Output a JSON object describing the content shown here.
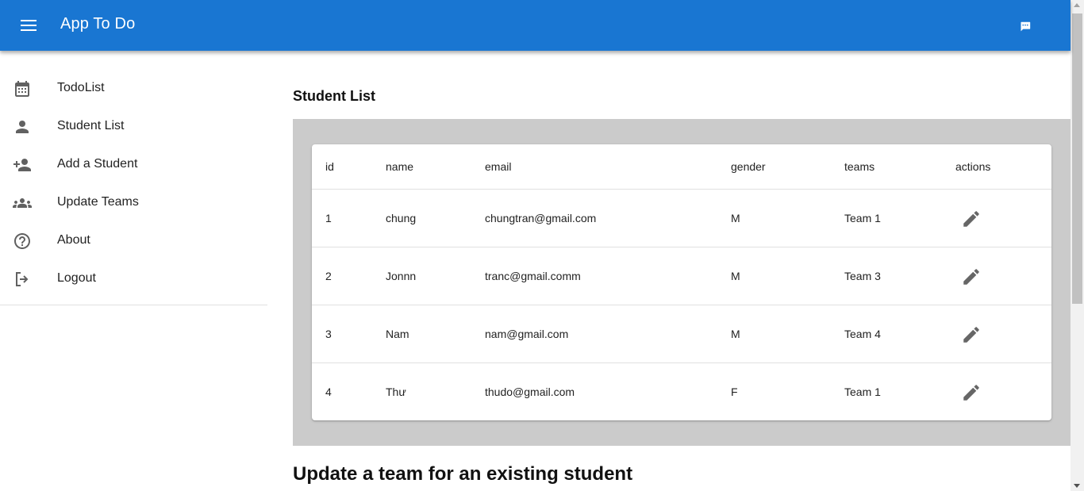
{
  "appbar": {
    "title": "App To Do",
    "menu_icon": "menu-icon",
    "chat_icon": "chat-icon",
    "color": "#1976d2"
  },
  "drawer": {
    "items": [
      {
        "label": "TodoList",
        "icon": "calendar-icon"
      },
      {
        "label": "Student List",
        "icon": "person-icon"
      },
      {
        "label": "Add a Student",
        "icon": "person-add-icon"
      },
      {
        "label": "Update Teams",
        "icon": "group-icon"
      },
      {
        "label": "About",
        "icon": "help-icon"
      },
      {
        "label": "Logout",
        "icon": "logout-icon"
      }
    ]
  },
  "main": {
    "section_title": "Student List",
    "table": {
      "headers": {
        "id": "id",
        "name": "name",
        "email": "email",
        "gender": "gender",
        "teams": "teams",
        "actions": "actions"
      },
      "rows": [
        {
          "id": "1",
          "name": "chung",
          "email": "chungtran@gmail.com",
          "gender": "M",
          "teams": "Team 1",
          "action_icon": "edit-icon"
        },
        {
          "id": "2",
          "name": "Jonnn",
          "email": "tranc@gmail.comm",
          "gender": "M",
          "teams": "Team 3",
          "action_icon": "edit-icon"
        },
        {
          "id": "3",
          "name": "Nam",
          "email": "nam@gmail.com",
          "gender": "M",
          "teams": "Team 4",
          "action_icon": "edit-icon"
        },
        {
          "id": "4",
          "name": "Thư",
          "email": "thudo@gmail.com",
          "gender": "F",
          "teams": "Team 1",
          "action_icon": "edit-icon"
        }
      ]
    },
    "subheading": "Update a team for an existing student"
  }
}
